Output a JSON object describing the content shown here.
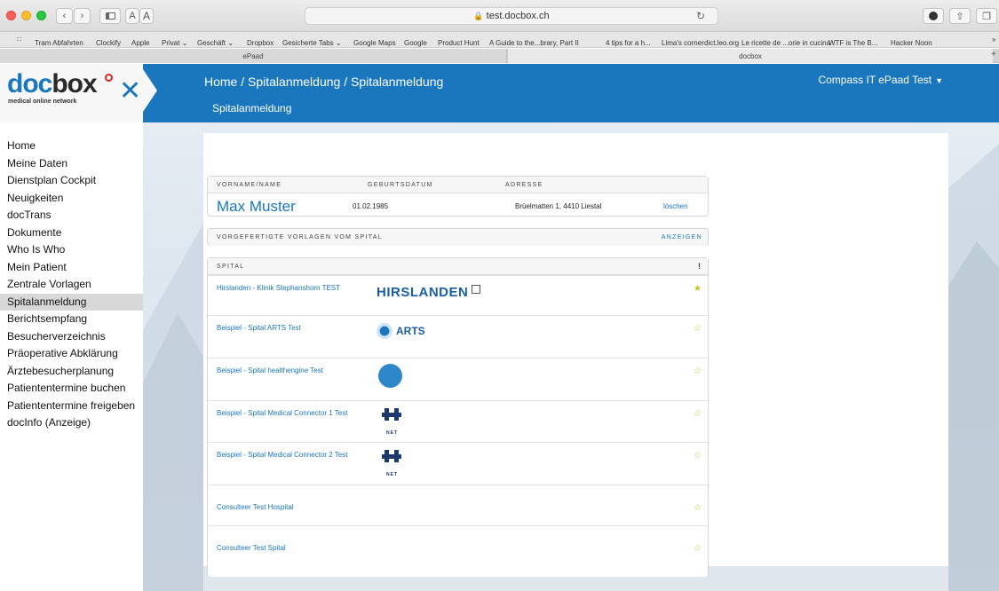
{
  "browser": {
    "url": "test.docbox.ch",
    "bookmarks": [
      "Tram Abfahrten",
      "Clockify",
      "Apple",
      "Privat ⌄",
      "Geschäft ⌄",
      "Dropbox",
      "Gesicherte Tabs ⌄",
      "Google Maps",
      "Google",
      "Product Hunt",
      "A Guide to the...brary, Part II",
      "4 tips for a h...",
      "Lima's corner",
      "dict.leo.org",
      "Le ricette de ...orie in cucina",
      "WTF is The B...",
      "Hacker Noon"
    ],
    "tabs": [
      "ePaad",
      "docbox"
    ],
    "reader_small": "A",
    "reader_large": "A"
  },
  "logo": {
    "brand_left": "doc",
    "brand_right": "box",
    "tagline": "medical online network"
  },
  "header": {
    "breadcrumb": "Home / Spitalanmeldung / Spitalanmeldung",
    "subtitle": "Spitalanmeldung",
    "user": "Compass IT ePaad Test"
  },
  "nav": {
    "items": [
      "Home",
      "Meine Daten",
      "Dienstplan Cockpit",
      "Neuigkeiten",
      "docTrans",
      "Dokumente",
      "Who Is Who",
      "Mein Patient",
      "Zentrale Vorlagen",
      "Spitalanmeldung",
      "Berichtsempfang",
      "Besucherverzeichnis",
      "Präoperative Abklärung",
      "Ärztebesucherplanung",
      "Patiententermine buchen",
      "Patiententermine freigeben",
      "docInfo (Anzeige)"
    ],
    "active": "Spitalanmeldung"
  },
  "patient": {
    "headers": [
      "VORNAME/NAME",
      "GEBURTSDATUM",
      "ADRESSE"
    ],
    "name": "Max Muster",
    "dob": "01.02.1985",
    "address": "Brüelmatten 1, 4410 Liestal",
    "delete_label": "löschen"
  },
  "templates": {
    "title": "VORGEFERTIGTE VORLAGEN VOM SPITAL",
    "action": "ANZEIGEN"
  },
  "hospitals": {
    "header": "SPITAL",
    "header_mark": "!",
    "rows": [
      {
        "name": "Hirslanden - Klinik Stephanshorn TEST",
        "logo": "HIRSLANDEN",
        "favorite": true
      },
      {
        "name": "Beispiel - Spital ARTS Test",
        "logo": "ARTS",
        "favorite": false
      },
      {
        "name": "Beispiel - Spital healthengine Test",
        "logo": "healthengine-globe",
        "favorite": false
      },
      {
        "name": "Beispiel - Spital Medical Connector 1 Test",
        "logo": "H-NET",
        "favorite": false
      },
      {
        "name": "Beispiel - Spital Medical Connector 2 Test",
        "logo": "H-NET",
        "favorite": false
      },
      {
        "name": "Consulteer Test Hospital",
        "logo": "",
        "favorite": false
      },
      {
        "name": "Consulteer Test Spital",
        "logo": "",
        "favorite": false
      }
    ]
  },
  "logo_texts": {
    "hirslanden": "HIRSLANDEN",
    "arts": "ARTS",
    "net": "NET"
  },
  "icons": {
    "star_filled": "★",
    "star_empty": "☆"
  },
  "colors": {
    "brand_blue": "#1a76bd",
    "star": "#c9c021",
    "active_nav": "#d7d7d7"
  }
}
